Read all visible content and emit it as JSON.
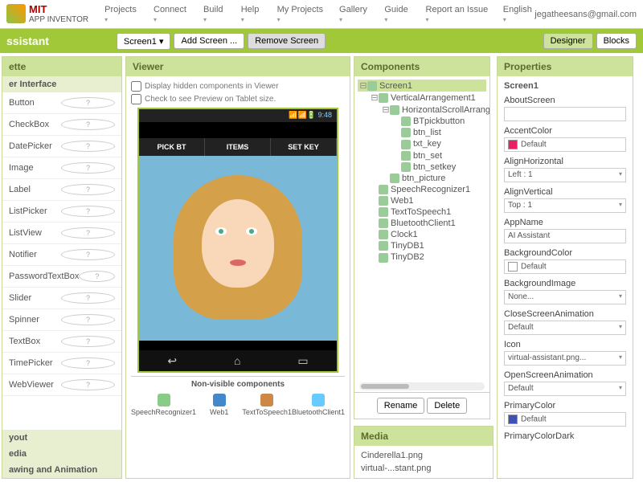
{
  "logo": {
    "mit": "MIT",
    "sub": "APP INVENTOR"
  },
  "topnav": [
    "Projects",
    "Connect",
    "Build",
    "Help",
    "My Projects",
    "Gallery",
    "Guide",
    "Report an Issue",
    "English"
  ],
  "user": "jegatheesans@gmail.com",
  "project_title": "ssistant",
  "toolbar": {
    "screen": "Screen1 ▾",
    "add": "Add Screen ...",
    "remove": "Remove Screen",
    "designer": "Designer",
    "blocks": "Blocks"
  },
  "panels": {
    "palette": "ette",
    "viewer": "Viewer",
    "components": "Components",
    "properties": "Properties",
    "media": "Media"
  },
  "palette_sections": {
    "ui": "er Interface",
    "layout": "yout",
    "media": "edia",
    "draw": "awing and Animation"
  },
  "palette_items": [
    "Button",
    "CheckBox",
    "DatePicker",
    "Image",
    "Label",
    "ListPicker",
    "ListView",
    "Notifier",
    "PasswordTextBox",
    "Slider",
    "Spinner",
    "TextBox",
    "TimePicker",
    "WebViewer"
  ],
  "viewer_opts": {
    "hidden": "Display hidden components in Viewer",
    "tablet": "Check to see Preview on Tablet size."
  },
  "phone": {
    "time": "9:48",
    "tabs": [
      "PICK BT",
      "ITEMS",
      "SET KEY"
    ]
  },
  "nonvis_header": "Non-visible components",
  "nonvis": [
    "SpeechRecognizer1",
    "Web1",
    "TextToSpeech1",
    "BluetoothClient1"
  ],
  "tree": [
    {
      "d": 0,
      "e": "⊟",
      "n": "Screen1",
      "sel": true
    },
    {
      "d": 1,
      "e": "⊟",
      "n": "VerticalArrangement1"
    },
    {
      "d": 2,
      "e": "⊟",
      "n": "HorizontalScrollArrang"
    },
    {
      "d": 3,
      "e": "",
      "n": "BTpickbutton"
    },
    {
      "d": 3,
      "e": "",
      "n": "btn_list"
    },
    {
      "d": 3,
      "e": "",
      "n": "txt_key"
    },
    {
      "d": 3,
      "e": "",
      "n": "btn_set"
    },
    {
      "d": 3,
      "e": "",
      "n": "btn_setkey"
    },
    {
      "d": 2,
      "e": "",
      "n": "btn_picture"
    },
    {
      "d": 1,
      "e": "",
      "n": "SpeechRecognizer1"
    },
    {
      "d": 1,
      "e": "",
      "n": "Web1"
    },
    {
      "d": 1,
      "e": "",
      "n": "TextToSpeech1"
    },
    {
      "d": 1,
      "e": "",
      "n": "BluetoothClient1"
    },
    {
      "d": 1,
      "e": "",
      "n": "Clock1"
    },
    {
      "d": 1,
      "e": "",
      "n": "TinyDB1"
    },
    {
      "d": 1,
      "e": "",
      "n": "TinyDB2"
    }
  ],
  "comp_buttons": {
    "rename": "Rename",
    "delete": "Delete"
  },
  "media_files": [
    "Cinderella1.png",
    "virtual-...stant.png"
  ],
  "props_title": "Screen1",
  "properties": [
    {
      "l": "AboutScreen",
      "v": "",
      "t": "txt"
    },
    {
      "l": "AccentColor",
      "v": "Default",
      "t": "col",
      "c": "#e91e63"
    },
    {
      "l": "AlignHorizontal",
      "v": "Left : 1",
      "t": "dd"
    },
    {
      "l": "AlignVertical",
      "v": "Top : 1",
      "t": "dd"
    },
    {
      "l": "AppName",
      "v": "AI Assistant",
      "t": "txt"
    },
    {
      "l": "BackgroundColor",
      "v": "Default",
      "t": "col",
      "c": "#fff"
    },
    {
      "l": "BackgroundImage",
      "v": "None...",
      "t": "dd"
    },
    {
      "l": "CloseScreenAnimation",
      "v": "Default",
      "t": "dd"
    },
    {
      "l": "Icon",
      "v": "virtual-assistant.png...",
      "t": "dd"
    },
    {
      "l": "OpenScreenAnimation",
      "v": "Default",
      "t": "dd"
    },
    {
      "l": "PrimaryColor",
      "v": "Default",
      "t": "col",
      "c": "#3f51b5"
    },
    {
      "l": "PrimaryColorDark",
      "v": "",
      "t": "lbl"
    }
  ]
}
